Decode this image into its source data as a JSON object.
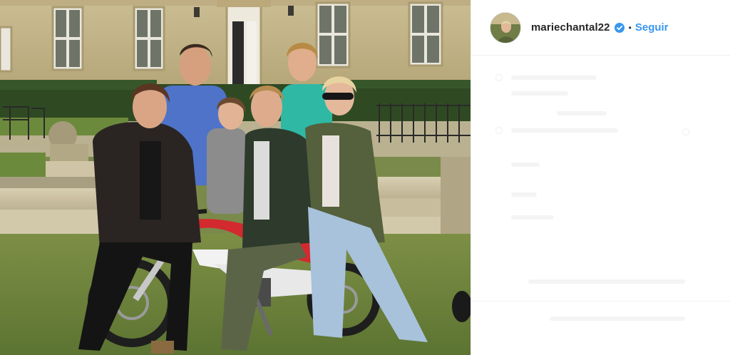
{
  "post": {
    "photo_alt": "",
    "author": {
      "username": "mariechantal22",
      "verified": true,
      "follow_label": "Seguir",
      "separator": "•"
    },
    "icons": {
      "verified": "verified-badge-icon",
      "avatar": "profile-avatar"
    },
    "colors": {
      "follow": "#3897f0",
      "verified": "#3897f0",
      "username": "#262626"
    }
  }
}
